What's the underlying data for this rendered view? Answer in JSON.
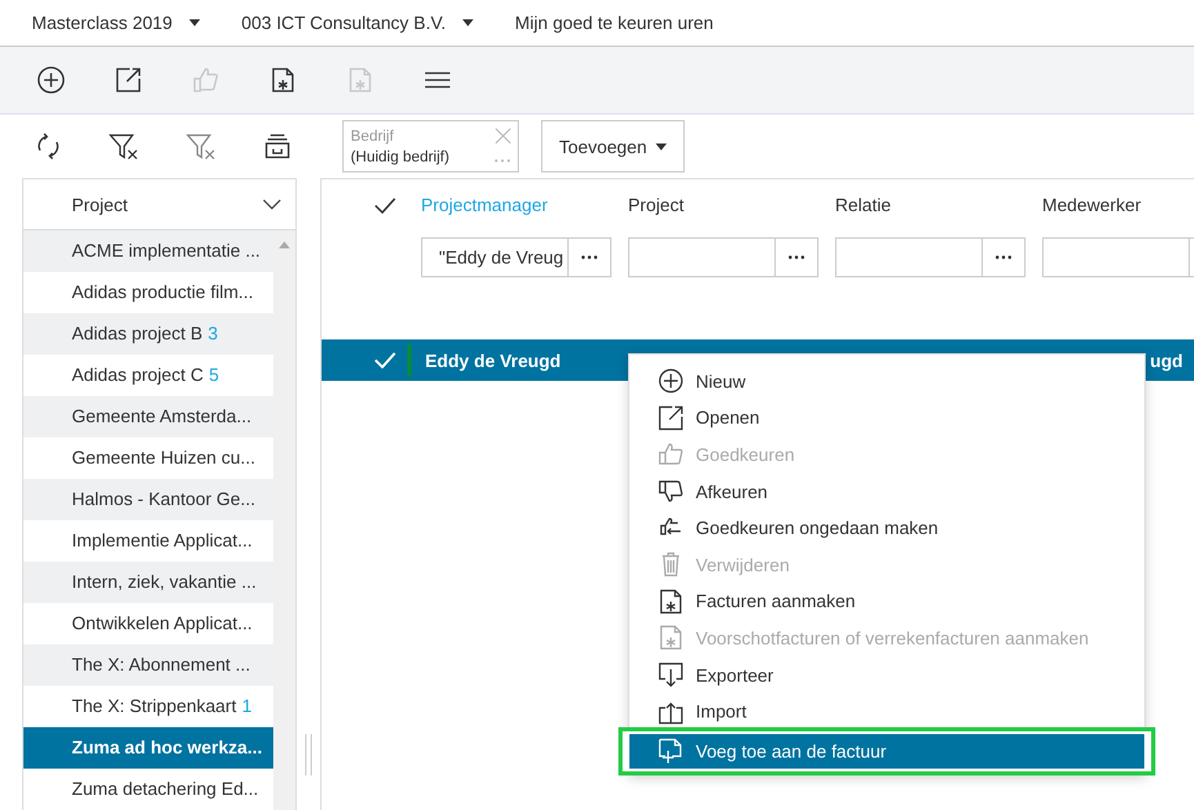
{
  "top_nav": [
    {
      "label": "Masterclass 2019",
      "dropdown": true
    },
    {
      "label": "003 ICT Consultancy B.V.",
      "dropdown": true
    },
    {
      "label": "Mijn goed te keuren uren",
      "dropdown": false
    }
  ],
  "toolbar": [
    {
      "disabled": false
    },
    {
      "disabled": false
    },
    {
      "disabled": true
    },
    {
      "disabled": false
    },
    {
      "disabled": true
    },
    {
      "disabled": false
    }
  ],
  "filter_bar": {
    "company_field": {
      "label": "Bedrijf",
      "value": "(Huidig bedrijf)"
    },
    "add_button": "Toevoegen"
  },
  "project_panel": {
    "header": "Project",
    "items": [
      {
        "name": "ACME implementatie ...",
        "selected": false
      },
      {
        "name": "Adidas productie film...",
        "selected": false
      },
      {
        "name": "Adidas project B",
        "count": "3",
        "selected": false
      },
      {
        "name": "Adidas project C",
        "count": "5",
        "selected": false
      },
      {
        "name": "Gemeente Amsterda...",
        "selected": false
      },
      {
        "name": "Gemeente Huizen cu...",
        "selected": false
      },
      {
        "name": "Halmos - Kantoor Ge...",
        "selected": false
      },
      {
        "name": "Implementie Applicat...",
        "selected": false
      },
      {
        "name": "Intern, ziek, vakantie ...",
        "selected": false
      },
      {
        "name": "Ontwikkelen Applicat...",
        "selected": false
      },
      {
        "name": "The X: Abonnement ...",
        "selected": false
      },
      {
        "name": "The X: Strippenkaart",
        "count": "1",
        "selected": false
      },
      {
        "name": "Zuma ad hoc werkza...",
        "selected": true
      },
      {
        "name": "Zuma detachering Ed...",
        "selected": false
      }
    ]
  },
  "grid": {
    "columns": [
      {
        "label": "Projectmanager",
        "active": true,
        "filter": "\"Eddy de Vreug"
      },
      {
        "label": "Project",
        "active": false
      },
      {
        "label": "Relatie",
        "active": false
      },
      {
        "label": "Medewerker",
        "active": false
      }
    ],
    "rows": [
      {
        "selected": true,
        "projectmanager": "Eddy de Vreugd",
        "trailing_text": "ugd"
      }
    ]
  },
  "context_menu": {
    "items": [
      {
        "label": "Nieuw",
        "disabled": false,
        "selected": false
      },
      {
        "label": "Openen",
        "disabled": false,
        "selected": false
      },
      {
        "label": "Goedkeuren",
        "disabled": true,
        "selected": false
      },
      {
        "label": "Afkeuren",
        "disabled": false,
        "selected": false
      },
      {
        "label": "Goedkeuren ongedaan maken",
        "disabled": false,
        "selected": false
      },
      {
        "label": "Verwijderen",
        "disabled": true,
        "selected": false
      },
      {
        "label": "Facturen aanmaken",
        "disabled": false,
        "selected": false
      },
      {
        "label": "Voorschotfacturen of verrekenfacturen aanmaken",
        "disabled": true,
        "selected": false
      },
      {
        "label": "Exporteer",
        "disabled": false,
        "selected": false
      },
      {
        "label": "Import",
        "disabled": false,
        "selected": false
      },
      {
        "label": "Voeg toe aan de factuur",
        "disabled": false,
        "selected": true
      }
    ]
  }
}
